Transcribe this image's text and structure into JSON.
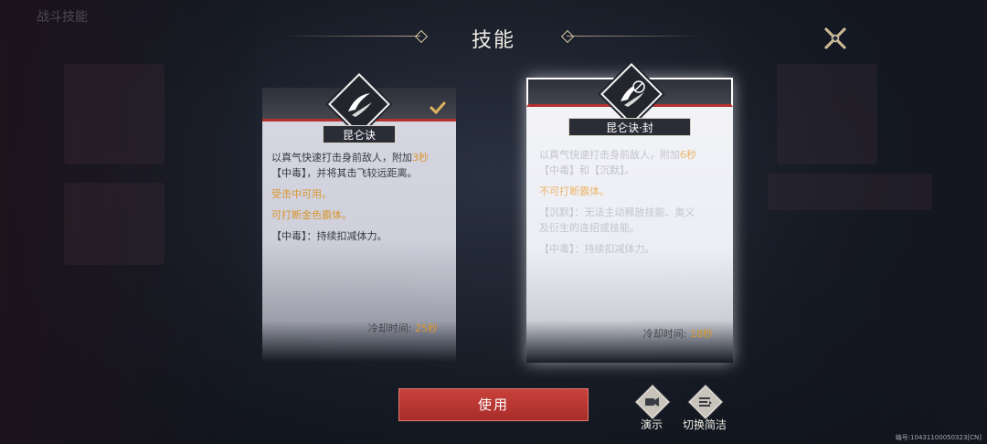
{
  "header": {
    "title": "技能",
    "top_left": "战斗技能"
  },
  "cards": [
    {
      "name": "昆仑诀",
      "selected": false,
      "checked": true,
      "desc": {
        "l1_a": "以真气快速打击身前敌人，附加",
        "l1_hl": "3秒",
        "l2": "【中毒】，并将其击飞较远距离。",
        "p2": "受击中可用。",
        "p3": "可打断金色霸体。",
        "p4": "【中毒】：持续扣减体力。"
      },
      "cooldown_label": "冷却时间:",
      "cooldown_value": "25秒"
    },
    {
      "name": "昆仑诀·封",
      "selected": true,
      "checked": false,
      "desc": {
        "l1_a": "以真气快速打击身前敌人，附加",
        "l1_hl": "6秒",
        "l2": "【中毒】和【沉默】。",
        "p2": "不可打断霸体。",
        "p3a": "【沉默】：无法主动释放技能、奥义",
        "p3b": "及衍生的连招或技能。",
        "p4": "【中毒】：持续扣减体力。"
      },
      "cooldown_label": "冷却时间:",
      "cooldown_value": "18秒"
    }
  ],
  "actions": {
    "use_label": "使用",
    "demo_label": "演示",
    "switch_label": "切换简洁"
  },
  "footer": {
    "id_text": "编号:10431100050323[CN]"
  },
  "icons": {
    "close": "close-x-icon",
    "check": "checkmark-icon",
    "skill": "skill-slash-emblem-icon",
    "demo": "video-camera-icon",
    "switch": "list-icon"
  },
  "colors": {
    "accent_red": "#b3322f",
    "highlight": "#d9962f",
    "button": "#c9413b"
  }
}
